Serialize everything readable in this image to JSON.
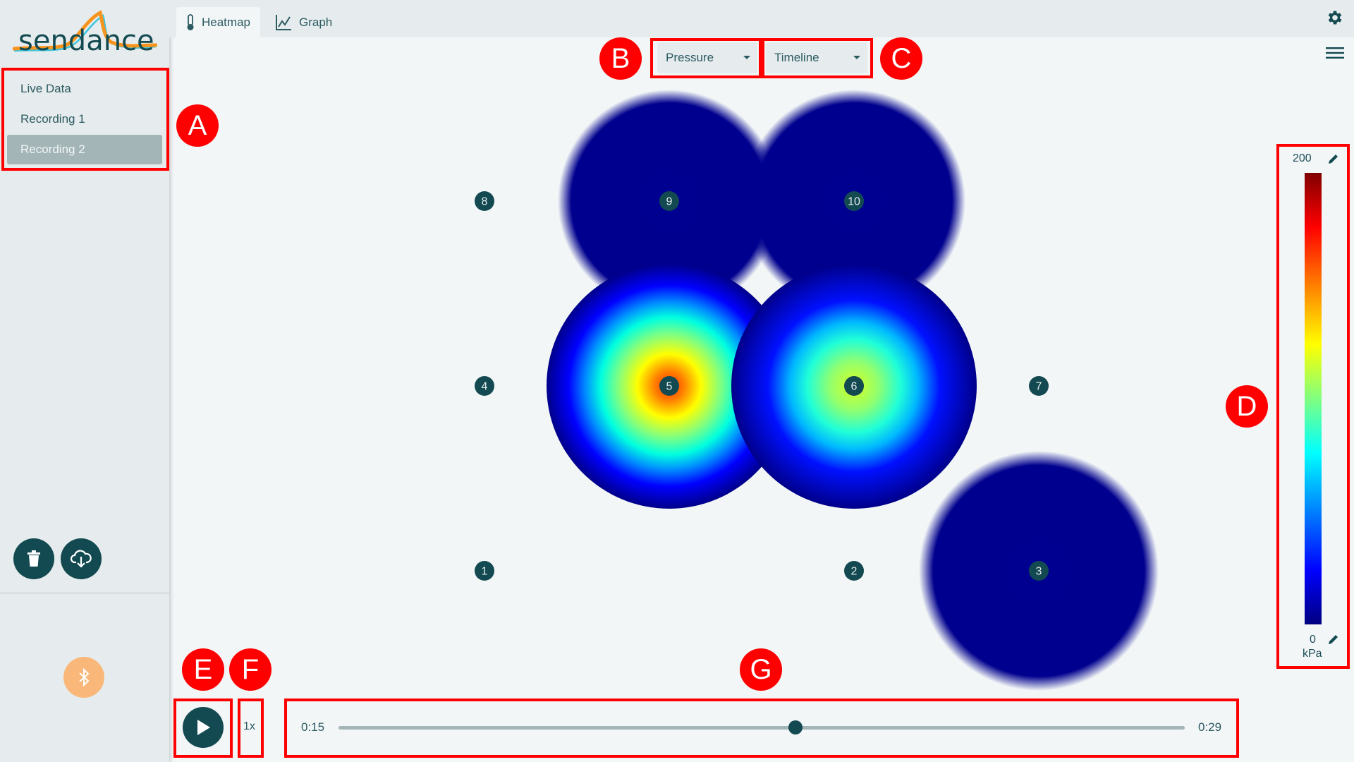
{
  "app": {
    "logo_text": "sendance"
  },
  "sidebar": {
    "items": [
      {
        "label": "Live Data",
        "active": false
      },
      {
        "label": "Recording 1",
        "active": false
      },
      {
        "label": "Recording 2",
        "active": true
      }
    ],
    "delete_icon": "trash-icon",
    "download_icon": "cloud-download-icon",
    "bluetooth_icon": "bluetooth-icon",
    "bluetooth_color": "#f9b87a"
  },
  "tabs": [
    {
      "label": "Heatmap",
      "icon": "thermometer-icon",
      "active": true
    },
    {
      "label": "Graph",
      "icon": "line-chart-icon",
      "active": false
    }
  ],
  "controls": {
    "metric_select": "Pressure",
    "view_select": "Timeline"
  },
  "heatmap": {
    "sensors": [
      {
        "label": "1",
        "level": 0
      },
      {
        "label": "2",
        "level": 0
      },
      {
        "label": "3",
        "level": 0.02
      },
      {
        "label": "4",
        "level": 0
      },
      {
        "label": "5",
        "level": 0.8
      },
      {
        "label": "6",
        "level": 0.55
      },
      {
        "label": "7",
        "level": 0
      },
      {
        "label": "8",
        "level": 0
      },
      {
        "label": "9",
        "level": 0.02
      },
      {
        "label": "10",
        "level": 0.02
      }
    ],
    "colormap": "jet",
    "node_color": "#134a51"
  },
  "colorbar": {
    "max": "200",
    "min": "0",
    "unit": "kPa"
  },
  "playback": {
    "speed": "1x",
    "current_time": "0:15",
    "end_time": "0:29",
    "progress": 0.54
  },
  "annotations": [
    "A",
    "B",
    "C",
    "D",
    "E",
    "F",
    "G"
  ],
  "colors": {
    "annotation": "#ff0000",
    "primary": "#134a51",
    "active_item": "#a3b5b7"
  }
}
